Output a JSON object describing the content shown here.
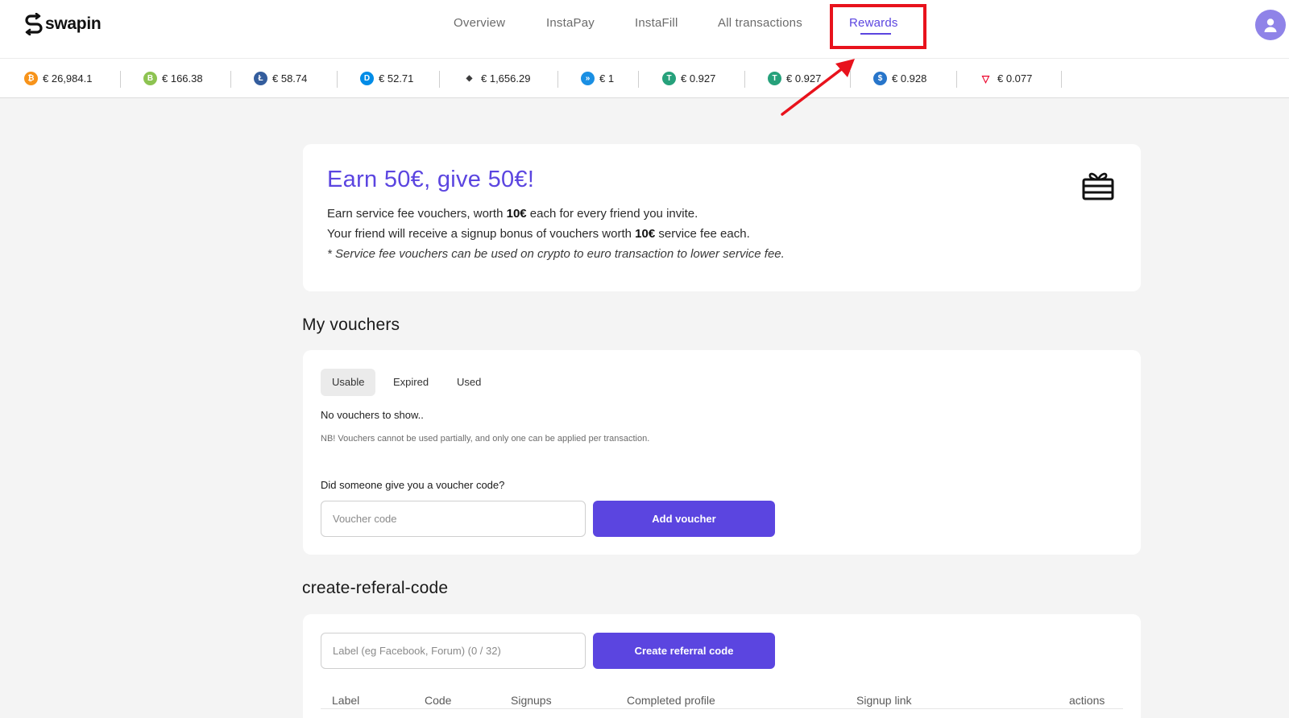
{
  "app": {
    "brand": "swapin"
  },
  "nav": {
    "items": [
      {
        "label": "Overview",
        "active": false
      },
      {
        "label": "InstaPay",
        "active": false
      },
      {
        "label": "InstaFill",
        "active": false
      },
      {
        "label": "All transactions",
        "active": false
      },
      {
        "label": "Rewards",
        "active": true
      }
    ]
  },
  "ticker": [
    {
      "coin": "bitcoin-icon",
      "price": "€ 26,984.1",
      "color": "#f7931a",
      "glyph": "₿"
    },
    {
      "coin": "bitcoin-cash-icon",
      "price": "€ 166.38",
      "color": "#8dc351",
      "glyph": "B"
    },
    {
      "coin": "litecoin-icon",
      "price": "€ 58.74",
      "color": "#345d9d",
      "glyph": "Ł"
    },
    {
      "coin": "dash-icon",
      "price": "€ 52.71",
      "color": "#008ce7",
      "glyph": "D"
    },
    {
      "coin": "ethereum-icon",
      "price": "€ 1,656.29",
      "color": "#3c3c3d",
      "glyph": "◆"
    },
    {
      "coin": "xrp-icon",
      "price": "€ 1",
      "color": "#1a8fe3",
      "glyph": "»"
    },
    {
      "coin": "tether-icon",
      "price": "€ 0.927",
      "color": "#26a17b",
      "glyph": "T"
    },
    {
      "coin": "tether-tron-icon",
      "price": "€ 0.927",
      "color": "#26a17b",
      "glyph": "T"
    },
    {
      "coin": "usdc-icon",
      "price": "€ 0.928",
      "color": "#2775ca",
      "glyph": "$"
    },
    {
      "coin": "tron-icon",
      "price": "€ 0.077",
      "color": "#eb0029",
      "glyph": "▽"
    }
  ],
  "earn": {
    "title": "Earn 50€, give 50€!",
    "line1_a": "Earn service fee vouchers, worth ",
    "line1_b": "10€",
    "line1_c": " each for every friend you invite.",
    "line2_a": "Your friend will receive a signup bonus of vouchers worth ",
    "line2_b": "10€",
    "line2_c": " service fee each.",
    "note": "* Service fee vouchers can be used on crypto to euro transaction to lower service fee.",
    "icon": "gift-card-icon"
  },
  "vouchers": {
    "title": "My vouchers",
    "tabs": [
      {
        "label": "Usable",
        "active": true
      },
      {
        "label": "Expired",
        "active": false
      },
      {
        "label": "Used",
        "active": false
      }
    ],
    "empty": "No vouchers to show..",
    "nb": "NB! Vouchers cannot be used partially, and only one can be applied per transaction.",
    "question": "Did someone give you a voucher code?",
    "input_placeholder": "Voucher code",
    "button": "Add voucher"
  },
  "referral": {
    "title": "create-referal-code",
    "input_placeholder": "Label (eg Facebook, Forum) (0 / 32)",
    "button": "Create referral code",
    "columns": [
      "Label",
      "Code",
      "Signups",
      "Completed profile",
      "Signup link",
      "actions"
    ]
  },
  "colors": {
    "accent": "#5b45e0",
    "highlight": "#e8121c",
    "background": "#f4f4f4"
  }
}
